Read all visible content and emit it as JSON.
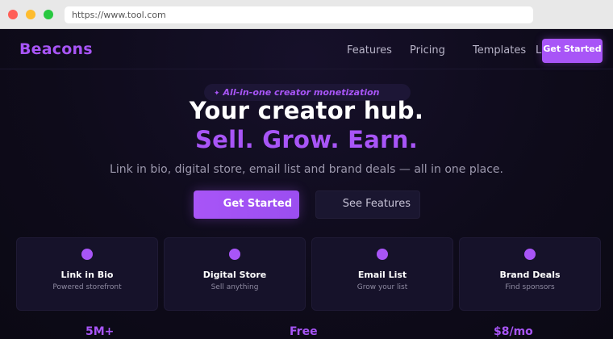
{
  "browser": {
    "url": "https://www.tool.com"
  },
  "nav": {
    "logo": "Beacons",
    "links": [
      "Features",
      "Pricing",
      "Templates",
      "L"
    ],
    "cta": "Get Started"
  },
  "hero": {
    "badge": "All-in-one creator monetization",
    "badge_icon": "sparkle-icon",
    "title_line1": "Your creator hub.",
    "title_line2": "Sell. Grow. Earn.",
    "subtitle": "Link in bio, digital store, email list and brand deals — all in one place.",
    "primary_button": "Get Started",
    "secondary_button": "See Features"
  },
  "features": [
    {
      "title": "Link in Bio",
      "desc": "Powered storefront"
    },
    {
      "title": "Digital Store",
      "desc": "Sell anything"
    },
    {
      "title": "Email List",
      "desc": "Grow your list"
    },
    {
      "title": "Brand Deals",
      "desc": "Find sponsors"
    }
  ],
  "stats": [
    "5M+",
    "Free",
    "$8/mo"
  ],
  "colors": {
    "accent": "#a855f7",
    "background": "#0d0a17",
    "card": "#16122a"
  }
}
